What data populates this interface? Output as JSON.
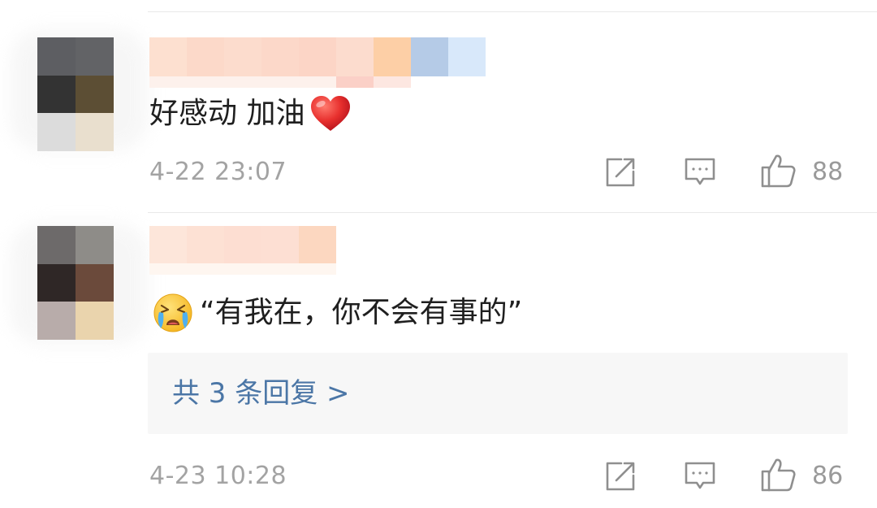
{
  "comments": [
    {
      "text": "好感动 加油",
      "time": "4-22 23:07",
      "likes": "88",
      "trailing_icon": "red-heart-emoji",
      "actions": [
        "share-icon",
        "comment-icon",
        "like-icon"
      ]
    },
    {
      "text": "“有我在，你不会有事的”",
      "time": "4-23 10:28",
      "likes": "86",
      "leading_icon": "crying-face-emoji",
      "reply_link": "共 3 条回复 >",
      "actions": [
        "share-icon",
        "comment-icon",
        "like-icon"
      ]
    }
  ],
  "colors": {
    "link": "#4b76a6",
    "meta": "#a3a3a3",
    "heart": "#e8302e",
    "reply_bg": "#f7f7f7"
  },
  "obscured": [
    "avatar-1",
    "username-1",
    "avatar-2",
    "username-2"
  ]
}
